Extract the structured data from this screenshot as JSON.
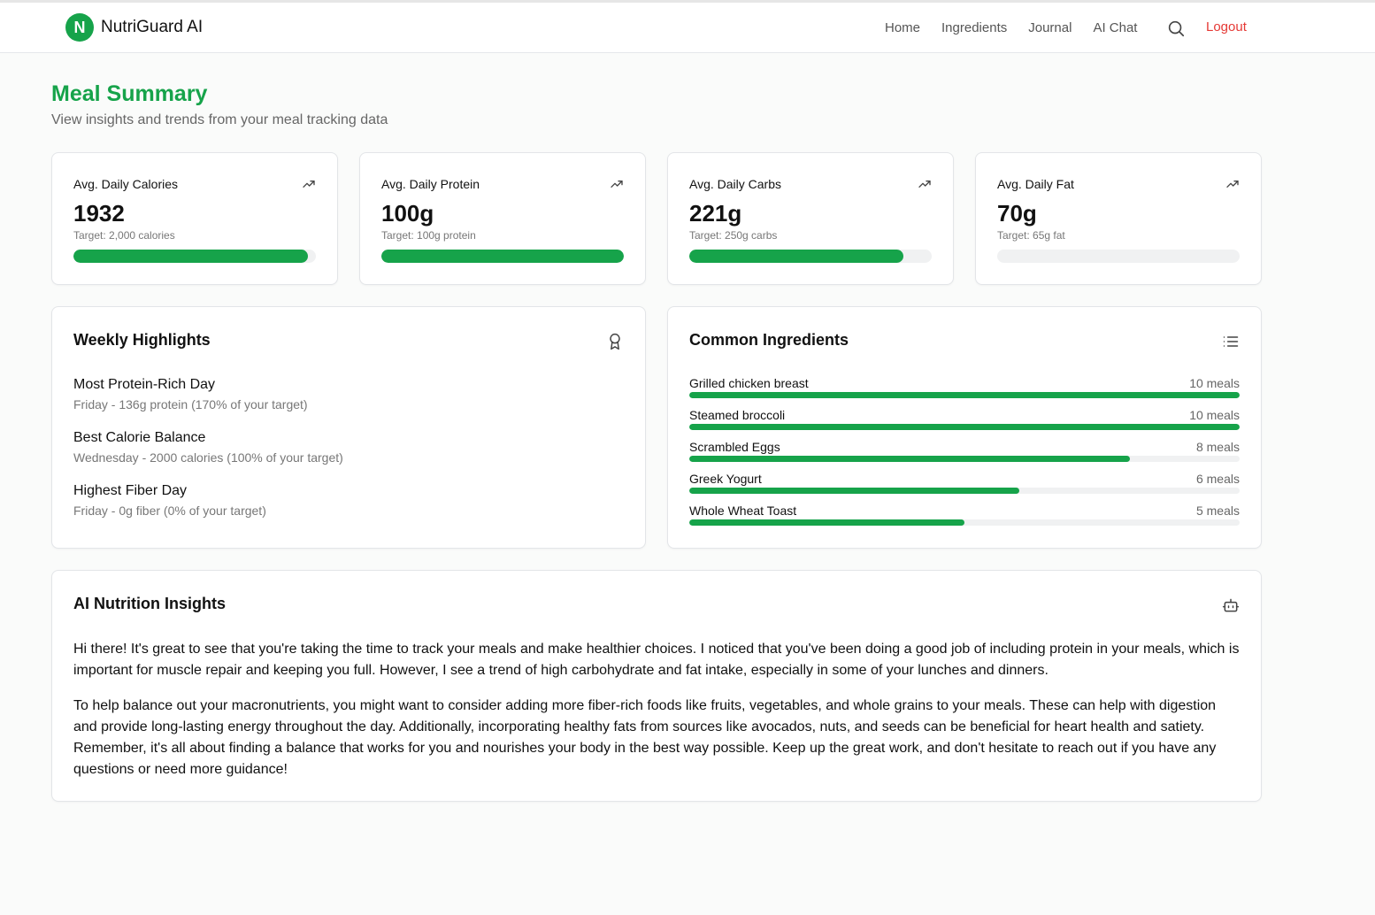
{
  "app": {
    "logo_letter": "N",
    "name": "NutriGuard AI"
  },
  "nav": {
    "links": [
      "Home",
      "Ingredients",
      "Journal",
      "AI Chat"
    ],
    "logout": "Logout"
  },
  "page": {
    "title": "Meal Summary",
    "subtitle": "View insights and trends from your meal tracking data"
  },
  "stats": [
    {
      "label": "Avg. Daily Calories",
      "value": "1932",
      "target": "Target: 2,000 calories",
      "progress": 0.966
    },
    {
      "label": "Avg. Daily Protein",
      "value": "100g",
      "target": "Target: 100g protein",
      "progress": 1.0
    },
    {
      "label": "Avg. Daily Carbs",
      "value": "221g",
      "target": "Target: 250g carbs",
      "progress": 0.884
    },
    {
      "label": "Avg. Daily Fat",
      "value": "70g",
      "target": "Target: 65g fat",
      "progress": 0
    }
  ],
  "highlights": {
    "title": "Weekly Highlights",
    "items": [
      {
        "title": "Most Protein-Rich Day",
        "desc": "Friday - 136g protein (170% of your target)"
      },
      {
        "title": "Best Calorie Balance",
        "desc": "Wednesday - 2000 calories (100% of your target)"
      },
      {
        "title": "Highest Fiber Day",
        "desc": "Friday - 0g fiber (0% of your target)"
      }
    ]
  },
  "ingredients": {
    "title": "Common Ingredients",
    "items": [
      {
        "name": "Grilled chicken breast",
        "count": "10 meals",
        "progress": 1.0
      },
      {
        "name": "Steamed broccoli",
        "count": "10 meals",
        "progress": 1.0
      },
      {
        "name": "Scrambled Eggs",
        "count": "8 meals",
        "progress": 0.8
      },
      {
        "name": "Greek Yogurt",
        "count": "6 meals",
        "progress": 0.6
      },
      {
        "name": "Whole Wheat Toast",
        "count": "5 meals",
        "progress": 0.5
      }
    ]
  },
  "insights": {
    "title": "AI Nutrition Insights",
    "paragraphs": [
      "Hi there! It's great to see that you're taking the time to track your meals and make healthier choices. I noticed that you've been doing a good job of including protein in your meals, which is important for muscle repair and keeping you full. However, I see a trend of high carbohydrate and fat intake, especially in some of your lunches and dinners.",
      "To help balance out your macronutrients, you might want to consider adding more fiber-rich foods like fruits, vegetables, and whole grains to your meals. These can help with digestion and provide long-lasting energy throughout the day. Additionally, incorporating healthy fats from sources like avocados, nuts, and seeds can be beneficial for heart health and satiety. Remember, it's all about finding a balance that works for you and nourishes your body in the best way possible. Keep up the great work, and don't hesitate to reach out if you have any questions or need more guidance!"
    ]
  },
  "icons": {
    "search": "search-icon",
    "trend": "trending-up-icon",
    "award": "award-icon",
    "list": "list-icon",
    "bot": "bot-icon"
  },
  "colors": {
    "accent": "#16a34a",
    "logout": "#e53935"
  }
}
